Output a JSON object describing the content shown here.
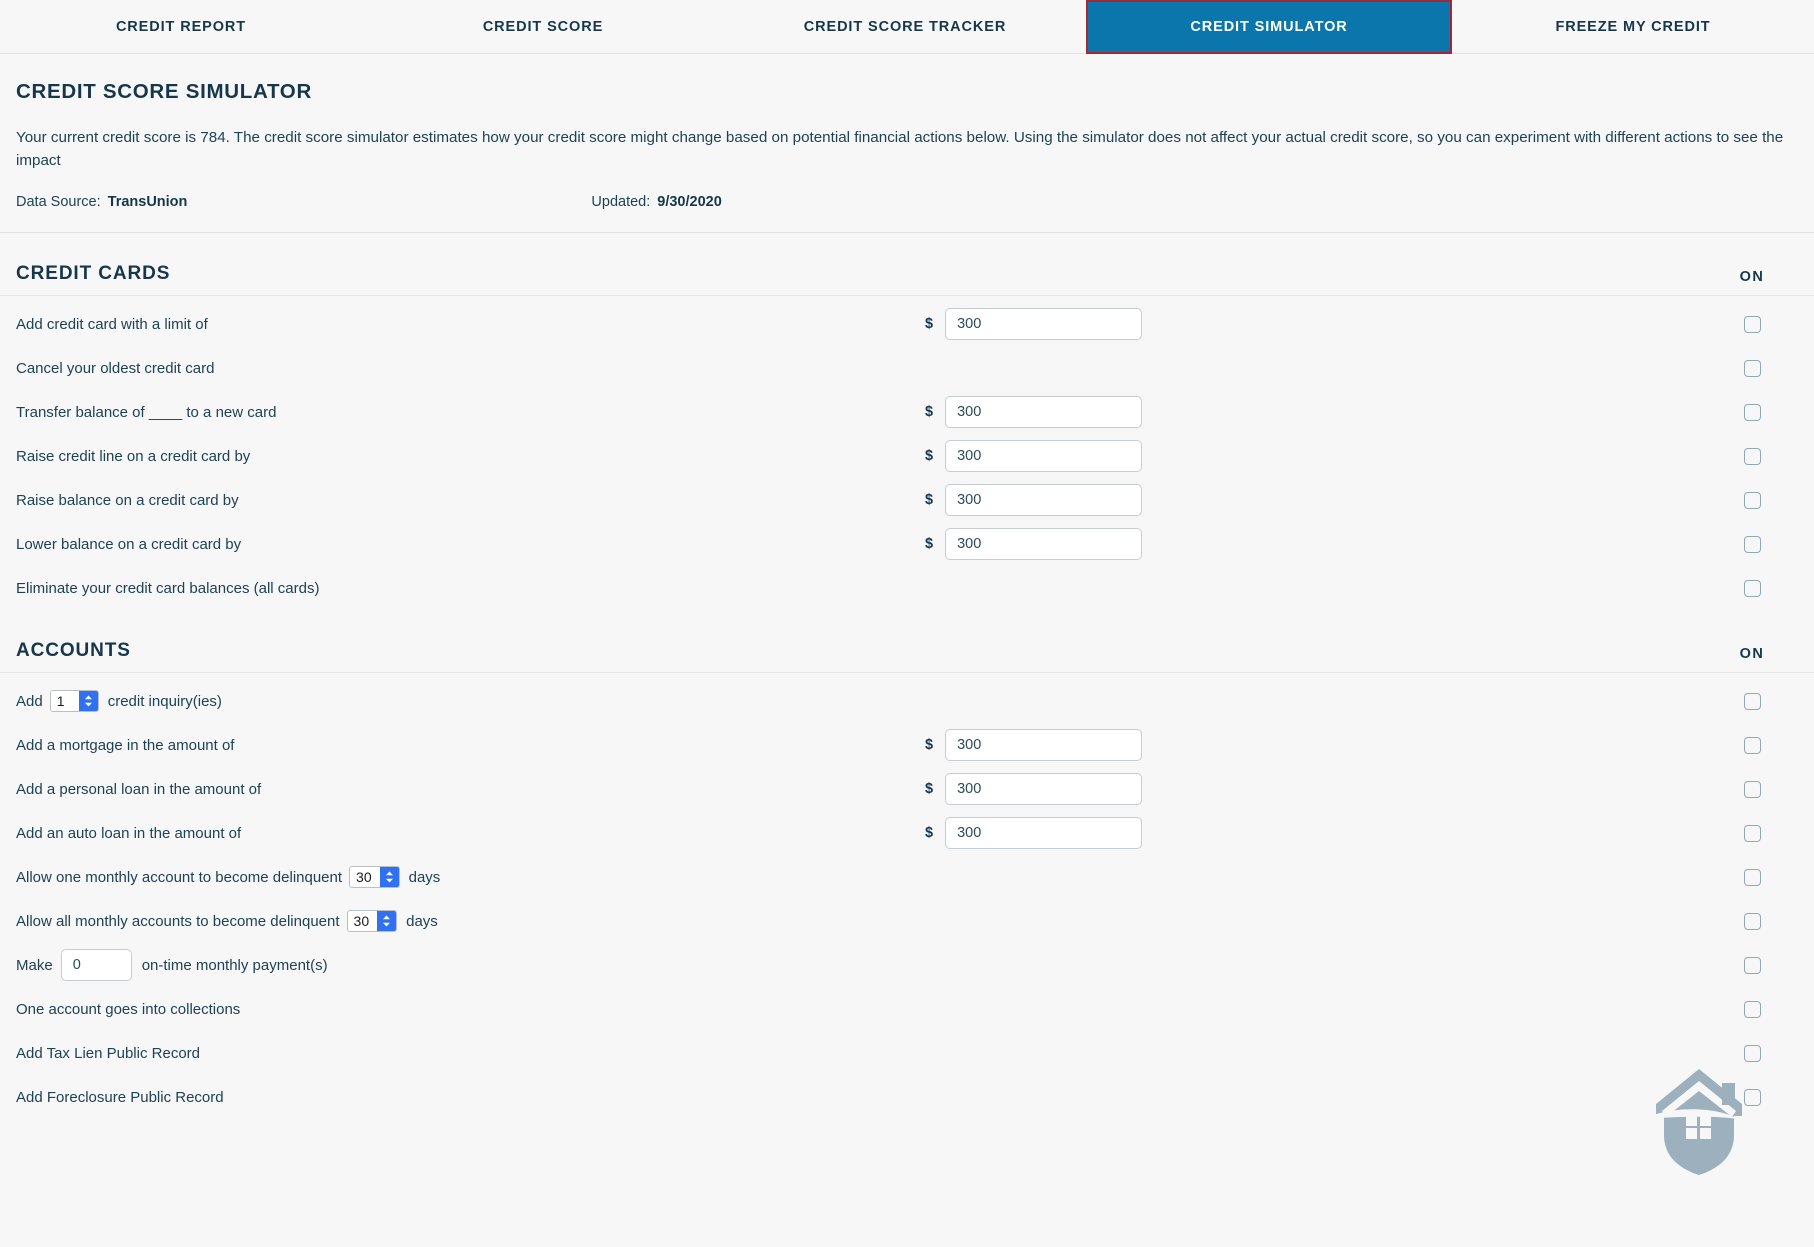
{
  "tabs": [
    {
      "label": "CREDIT REPORT",
      "active": false
    },
    {
      "label": "CREDIT SCORE",
      "active": false
    },
    {
      "label": "CREDIT SCORE TRACKER",
      "active": false
    },
    {
      "label": "CREDIT SIMULATOR",
      "active": true
    },
    {
      "label": "FREEZE MY CREDIT",
      "active": false
    }
  ],
  "header": {
    "title": "CREDIT SCORE SIMULATOR",
    "intro": "Your current credit score is 784. The credit score simulator estimates how your credit score might change based on potential financial actions below. Using the simulator does not affect your actual credit score, so you can experiment with different actions to see the impact",
    "data_source_label": "Data Source:",
    "data_source_value": "TransUnion",
    "updated_label": "Updated:",
    "updated_value": "9/30/2020",
    "current_score": "784"
  },
  "colors": {
    "accent_blue": "#0a76ab",
    "active_tab_border": "#a32833",
    "text_dark": "#16374b",
    "body_text": "#1e4255",
    "page_bg": "#f7f7f7",
    "input_border": "#c7ccd0",
    "checkbox_border": "#8fa9b8",
    "stepper_blue": "#3071f2",
    "watermark": "#9cb1bd"
  },
  "sections": [
    {
      "title": "CREDIT CARDS",
      "on_label": "ON",
      "rows": [
        {
          "label": "Add credit card with a limit of",
          "control": "amount",
          "prefix": "$",
          "value": "300",
          "checked": false
        },
        {
          "label": "Cancel your oldest credit card",
          "control": "none",
          "checked": false
        },
        {
          "label": "Transfer balance of ____ to a new card",
          "control": "amount",
          "prefix": "$",
          "value": "300",
          "checked": false
        },
        {
          "label": "Raise credit line on a credit card by",
          "control": "amount",
          "prefix": "$",
          "value": "300",
          "checked": false
        },
        {
          "label": "Raise balance on a credit card by",
          "control": "amount",
          "prefix": "$",
          "value": "300",
          "checked": false
        },
        {
          "label": "Lower balance on a credit card by",
          "control": "amount",
          "prefix": "$",
          "value": "300",
          "checked": false
        },
        {
          "label": "Eliminate your credit card balances (all cards)",
          "control": "none",
          "checked": false
        }
      ]
    },
    {
      "title": "ACCOUNTS",
      "on_label": "ON",
      "rows": [
        {
          "label": "Add",
          "control": "stepper",
          "value": "1",
          "suffix": "credit inquiry(ies)",
          "checked": false
        },
        {
          "label": "Add a mortgage in the amount of",
          "control": "amount",
          "prefix": "$",
          "value": "300",
          "checked": false
        },
        {
          "label": "Add a personal loan in the amount of",
          "control": "amount",
          "prefix": "$",
          "value": "300",
          "checked": false
        },
        {
          "label": "Add an auto loan in the amount of",
          "control": "amount",
          "prefix": "$",
          "value": "300",
          "checked": false
        },
        {
          "label": "Allow one monthly account to become delinquent",
          "control": "stepper",
          "value": "30",
          "suffix": "days",
          "checked": false
        },
        {
          "label": "Allow all monthly accounts to become delinquent",
          "control": "stepper",
          "value": "30",
          "suffix": "days",
          "checked": false
        },
        {
          "label": "Make",
          "control": "textbox",
          "value": "0",
          "suffix": "on-time monthly payment(s)",
          "checked": false
        },
        {
          "label": "One account goes into collections",
          "control": "none",
          "checked": false
        },
        {
          "label": "Add Tax Lien Public Record",
          "control": "none",
          "checked": false
        },
        {
          "label": "Add Foreclosure Public Record",
          "control": "none",
          "checked": false
        }
      ]
    }
  ],
  "watermark": {
    "icon": "house-shield-icon"
  }
}
